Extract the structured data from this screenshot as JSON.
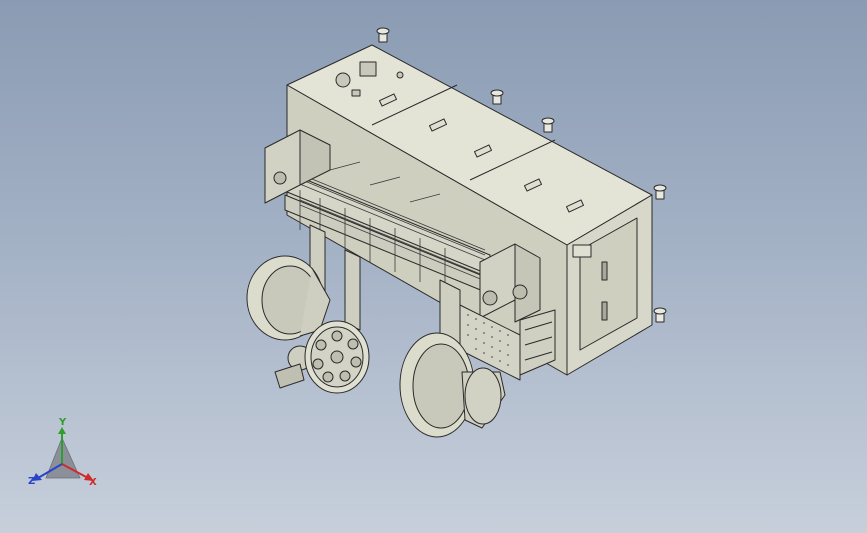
{
  "view": {
    "background_top": "#8a9bb3",
    "background_bottom": "#c7cfdb",
    "model_fill": "#dcdccc",
    "model_edge": "#2a2a2a"
  },
  "triad": {
    "y_label": "Y",
    "x_label": "X",
    "z_label": "Z",
    "x_color": "#d12a2a",
    "y_color": "#2f9e2f",
    "z_color": "#2a44c8",
    "icon": "view-orientation-triad-icon"
  }
}
